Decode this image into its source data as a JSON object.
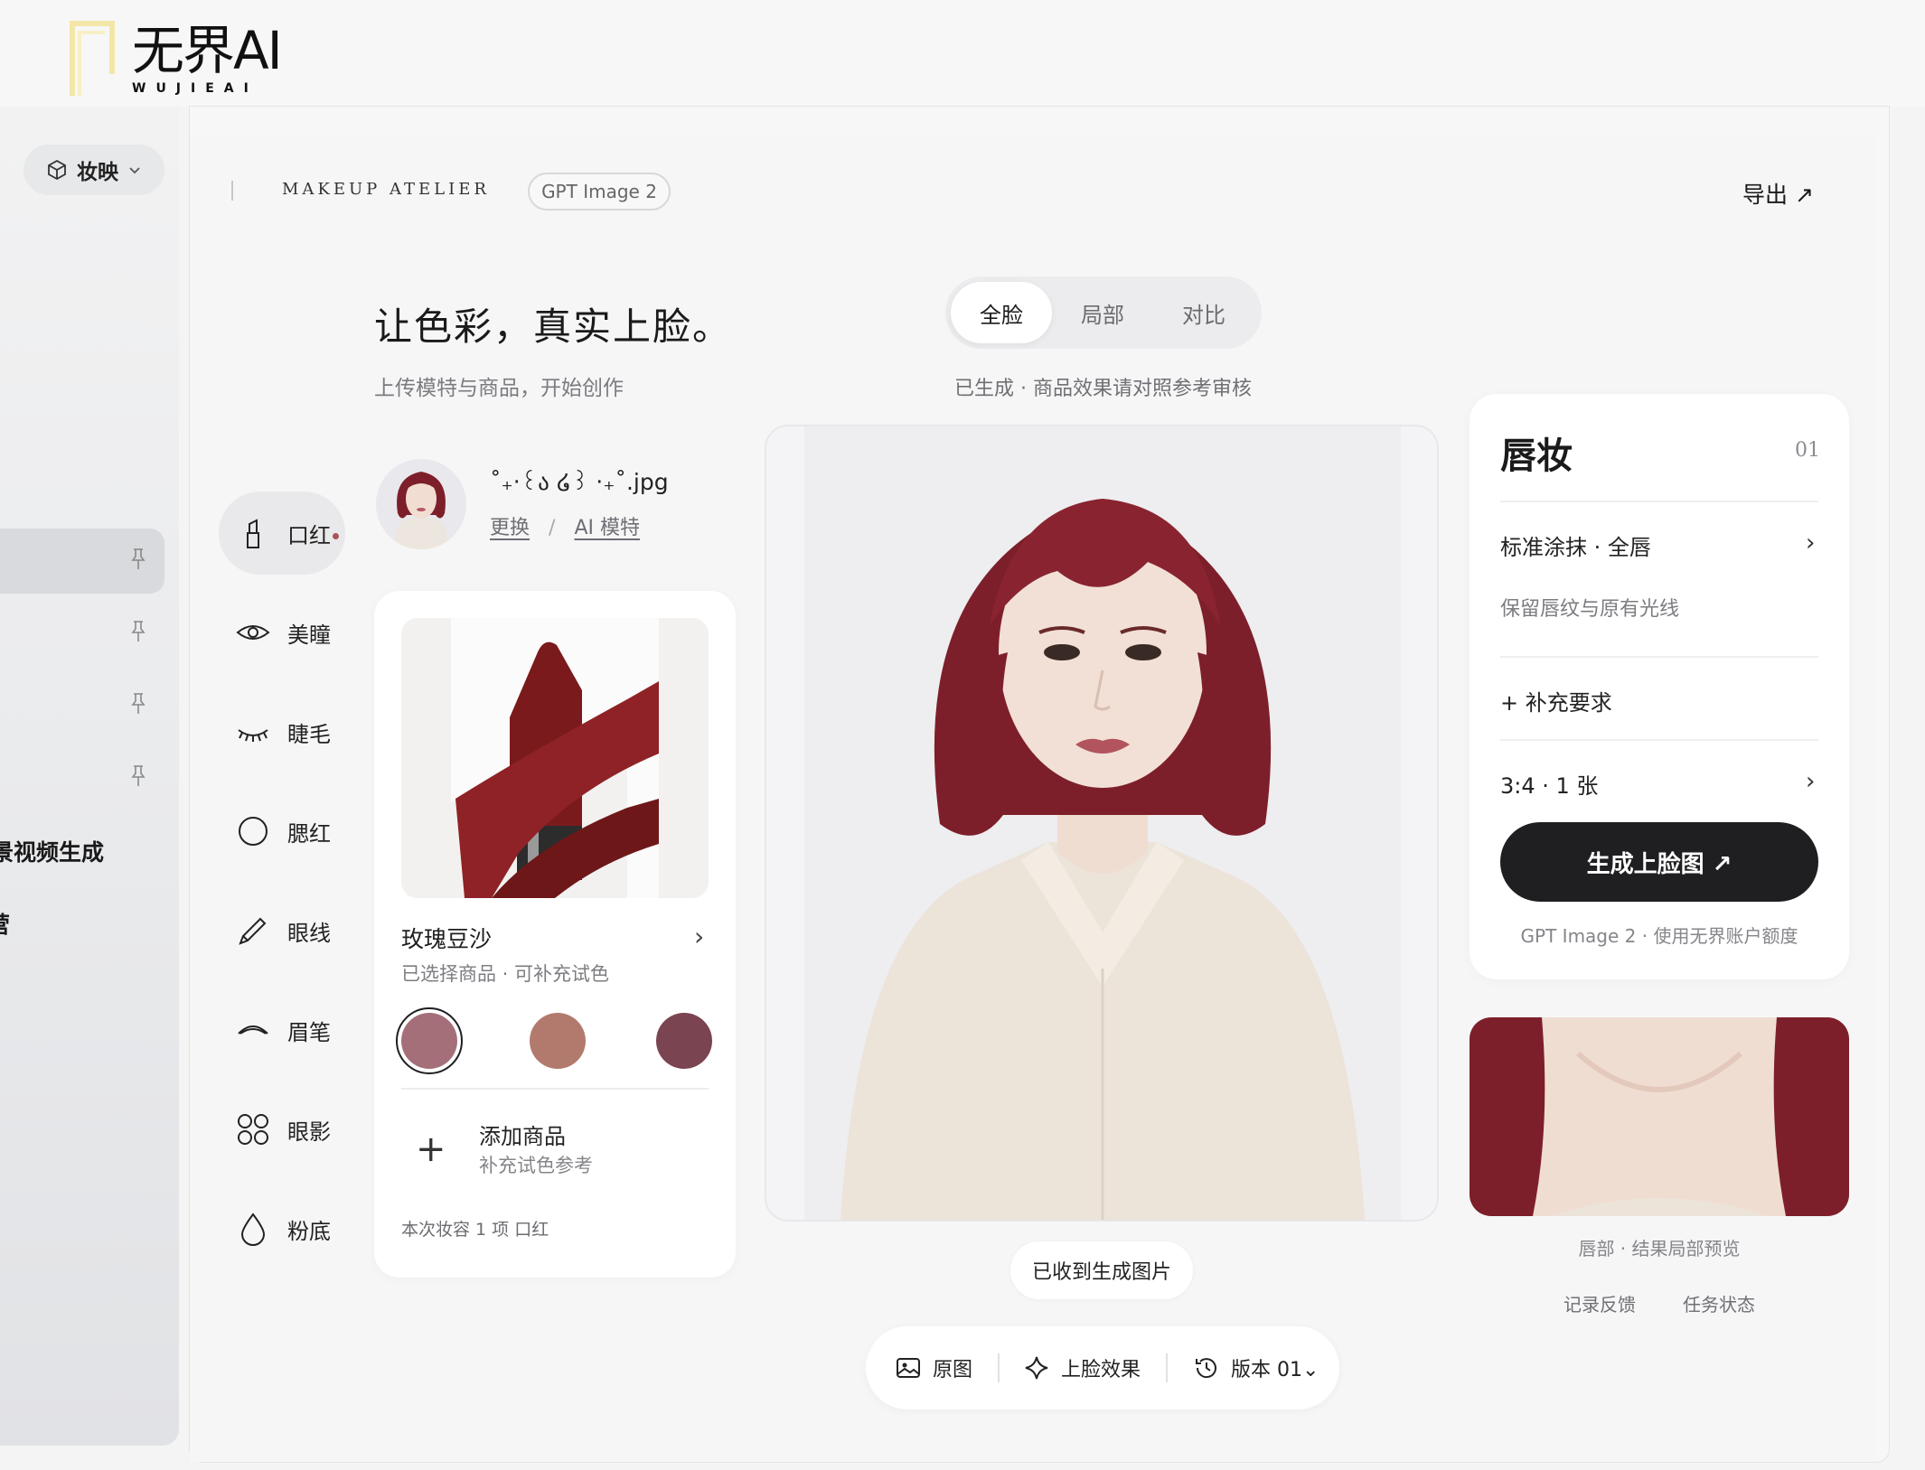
{
  "app": {
    "logo_text": "无界AI",
    "logo_sub": "WUJIEAI"
  },
  "sidebar": {
    "module_label": "妆映",
    "items": [
      {
        "label": ""
      },
      {
        "label": ""
      },
      {
        "label": ""
      },
      {
        "label": ""
      }
    ],
    "text_items": [
      "景视频生成",
      "营"
    ]
  },
  "header": {
    "brand": "MAKEUP ATELIER",
    "model_chip": "GPT Image 2",
    "export_label": "导出 ↗"
  },
  "hero": {
    "title": "让色彩，真实上脸。",
    "subtitle": "上传模特与商品，开始创作"
  },
  "categories": [
    {
      "label": "口红",
      "icon": "lipstick-icon",
      "active": true
    },
    {
      "label": "美瞳",
      "icon": "eye-icon",
      "active": false
    },
    {
      "label": "睫毛",
      "icon": "eyelash-icon",
      "active": false
    },
    {
      "label": "腮红",
      "icon": "circle-icon",
      "active": false
    },
    {
      "label": "眼线",
      "icon": "pencil-icon",
      "active": false
    },
    {
      "label": "眉笔",
      "icon": "brow-icon",
      "active": false
    },
    {
      "label": "眼影",
      "icon": "palette-icon",
      "active": false
    },
    {
      "label": "粉底",
      "icon": "drop-icon",
      "active": false
    }
  ],
  "model": {
    "file_name": "˚₊‧꒰ა ໒꒱ ‧₊˚.jpg",
    "replace_link": "更换",
    "divider": "/",
    "ai_model_link": "AI 模特"
  },
  "product": {
    "name": "玫瑰豆沙",
    "chevron": "›",
    "subtitle": "已选择商品 · 可补充试色",
    "swatches": [
      "#a56f7a",
      "#b27a6d",
      "#7a4450"
    ],
    "selected_swatch": 0,
    "add_plus": "+",
    "add_title": "添加商品",
    "add_subtitle": "补充试色参考",
    "summary": "本次妆容 1 项    口红"
  },
  "center": {
    "tabs": [
      "全脸",
      "局部",
      "对比"
    ],
    "active_tab": 0,
    "note": "已生成 · 商品效果请对照参考审核",
    "received": "已收到生成图片",
    "toolbar": {
      "original": "原图",
      "effect": "上脸效果",
      "version": "版本 01",
      "version_caret": "⌄"
    }
  },
  "panel": {
    "title": "唇妆",
    "number": "01",
    "mode": "标准涂抹 · 全唇",
    "mode_chevron": "›",
    "hint": "保留唇纹与原有光线",
    "extra": "+ 补充要求",
    "ratio": "3:4 · 1 张",
    "ratio_chevron": "›",
    "generate": "生成上脸图 ↗",
    "footer": "GPT Image 2 · 使用无界账户额度"
  },
  "preview": {
    "caption": "唇部 · 结果局部预览",
    "feedback": "记录反馈",
    "status": "任务状态"
  },
  "colors": {
    "accent_dark": "#1f1f22",
    "lip_accent": "#a8525b",
    "hair": "#7d1f2a"
  }
}
